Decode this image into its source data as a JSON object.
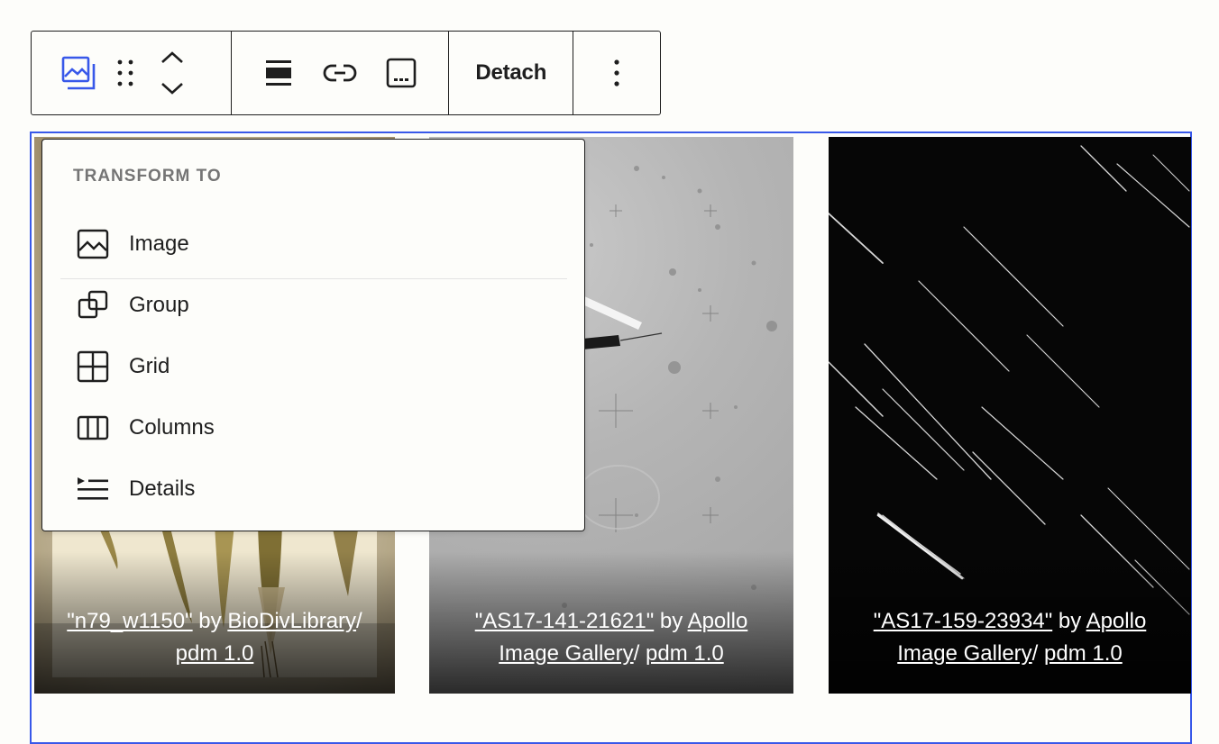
{
  "toolbar": {
    "detach_label": "Detach",
    "accent": "#3858e9"
  },
  "transform_menu": {
    "heading": "TRANSFORM TO",
    "items": [
      {
        "label": "Image",
        "icon": "image-icon"
      },
      {
        "label": "Group",
        "icon": "group-icon"
      },
      {
        "label": "Grid",
        "icon": "grid-icon"
      },
      {
        "label": "Columns",
        "icon": "columns-icon"
      },
      {
        "label": "Details",
        "icon": "details-icon"
      }
    ]
  },
  "gallery": {
    "images": [
      {
        "title": "\"n79_w1150\"",
        "by": " by ",
        "author": "BioDivLibrary",
        "sep": "/",
        "license": "pdm 1.0"
      },
      {
        "title": "\"AS17-141-21621\"",
        "by": " by ",
        "author": "Apollo Image Gallery",
        "sep": "/",
        "license": "pdm 1.0"
      },
      {
        "title": "\"AS17-159-23934\"",
        "by": " by ",
        "author": "Apollo Image Gallery",
        "sep": "/",
        "license": "pdm 1.0"
      }
    ]
  }
}
